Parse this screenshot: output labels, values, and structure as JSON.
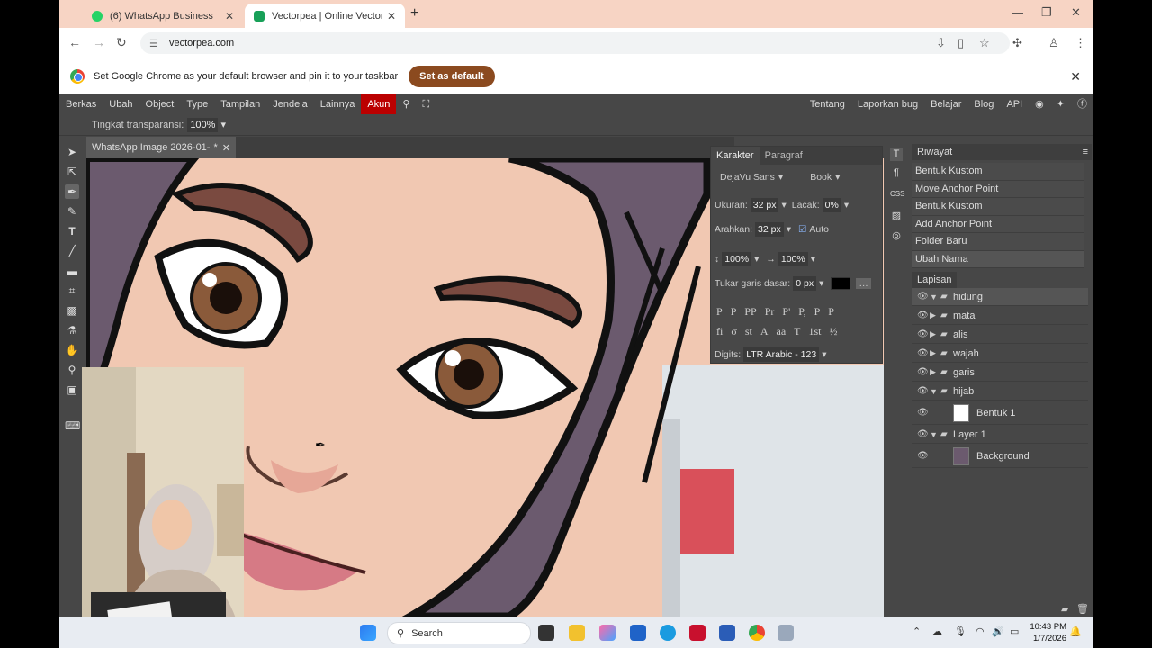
{
  "browser": {
    "tabs": [
      {
        "title": "(6) WhatsApp Business",
        "active": false,
        "favicon_color": "#25d366"
      },
      {
        "title": "Vectorpea | Online Vector Edito",
        "active": true,
        "favicon_color": "#18a058"
      }
    ],
    "url": "vectorpea.com",
    "infobar": {
      "message": "Set Google Chrome as your default browser and pin it to your taskbar",
      "button": "Set as default"
    }
  },
  "app": {
    "menu": [
      "Berkas",
      "Ubah",
      "Object",
      "Type",
      "Tampilan",
      "Jendela",
      "Lainnya",
      "Akun"
    ],
    "menu_right": [
      "Tentang",
      "Laporkan bug",
      "Belajar",
      "Blog",
      "API"
    ],
    "options": {
      "label": "Tingkat transparansi:",
      "value": "100%"
    },
    "document_tab": "WhatsApp Image 2026-01-",
    "document_tab_suffix": "*",
    "character_panel": {
      "tabs": [
        "Karakter",
        "Paragraf"
      ],
      "font": "DejaVu Sans",
      "style": "Book",
      "size_label": "Ukuran:",
      "size": "32 px",
      "tracking_label": "Lacak:",
      "tracking": "0%",
      "leading_label": "Arahkan:",
      "leading": "32 px",
      "auto_label": "Auto",
      "vscale": "100%",
      "hscale": "100%",
      "baseline_label": "Tukar garis dasar:",
      "baseline": "0 px",
      "digits_label": "Digits:",
      "digits": "LTR Arabic - 123",
      "glyph_row1": [
        "P",
        "P",
        "PP",
        "Pr",
        "P'",
        "P,",
        "P",
        "P"
      ],
      "glyph_row2": [
        "fi",
        "σ",
        "st",
        "A",
        "aa",
        "T",
        "1st",
        "½"
      ]
    },
    "history": {
      "title": "Riwayat",
      "items": [
        "Bentuk Kustom",
        "Move Anchor Point",
        "Bentuk Kustom",
        "Add Anchor Point",
        "Folder Baru",
        "Ubah Nama"
      ]
    },
    "layers": {
      "title": "Lapisan",
      "items": [
        {
          "name": "hidung",
          "type": "folder",
          "expanded": true,
          "indent": 0,
          "selected": true
        },
        {
          "name": "mata",
          "type": "folder",
          "expanded": false,
          "indent": 0
        },
        {
          "name": "alis",
          "type": "folder",
          "expanded": false,
          "indent": 0
        },
        {
          "name": "wajah",
          "type": "folder",
          "expanded": false,
          "indent": 0
        },
        {
          "name": "garis",
          "type": "folder",
          "expanded": false,
          "indent": 0
        },
        {
          "name": "hijab",
          "type": "folder",
          "expanded": true,
          "indent": 0
        },
        {
          "name": "Bentuk 1",
          "type": "shape",
          "indent": 1
        },
        {
          "name": "Layer 1",
          "type": "folder",
          "expanded": true,
          "indent": 0
        },
        {
          "name": "Background",
          "type": "image",
          "indent": 1
        }
      ]
    }
  },
  "taskbar": {
    "search": "Search",
    "time": "10:43 PM",
    "date": "1/7/2026"
  },
  "colors": {
    "infobar_button": "#8b4a1f",
    "akun_menu": "#bb0000",
    "skin": "#f1c8b2",
    "hijab": "#6b5a6e"
  }
}
